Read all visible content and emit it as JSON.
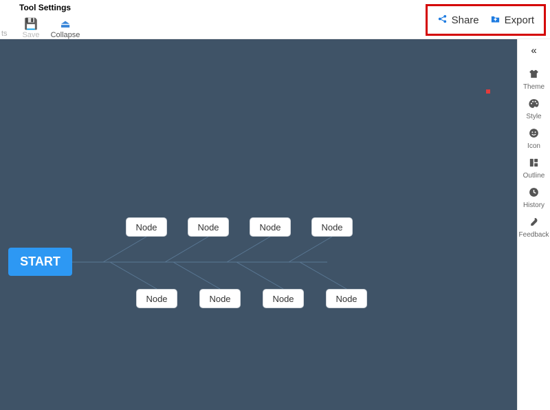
{
  "toolbar": {
    "section_label": "Tool Settings",
    "cut_text": "ts",
    "save_label": "Save",
    "collapse_label": "Collapse",
    "share_label": "Share",
    "export_label": "Export"
  },
  "diagram": {
    "root_label": "START",
    "top_nodes": [
      "Node",
      "Node",
      "Node",
      "Node"
    ],
    "bottom_nodes": [
      "Node",
      "Node",
      "Node",
      "Node"
    ]
  },
  "sidebar": {
    "items": [
      {
        "label": "Theme"
      },
      {
        "label": "Style"
      },
      {
        "label": "Icon"
      },
      {
        "label": "Outline"
      },
      {
        "label": "History"
      },
      {
        "label": "Feedback"
      }
    ]
  }
}
